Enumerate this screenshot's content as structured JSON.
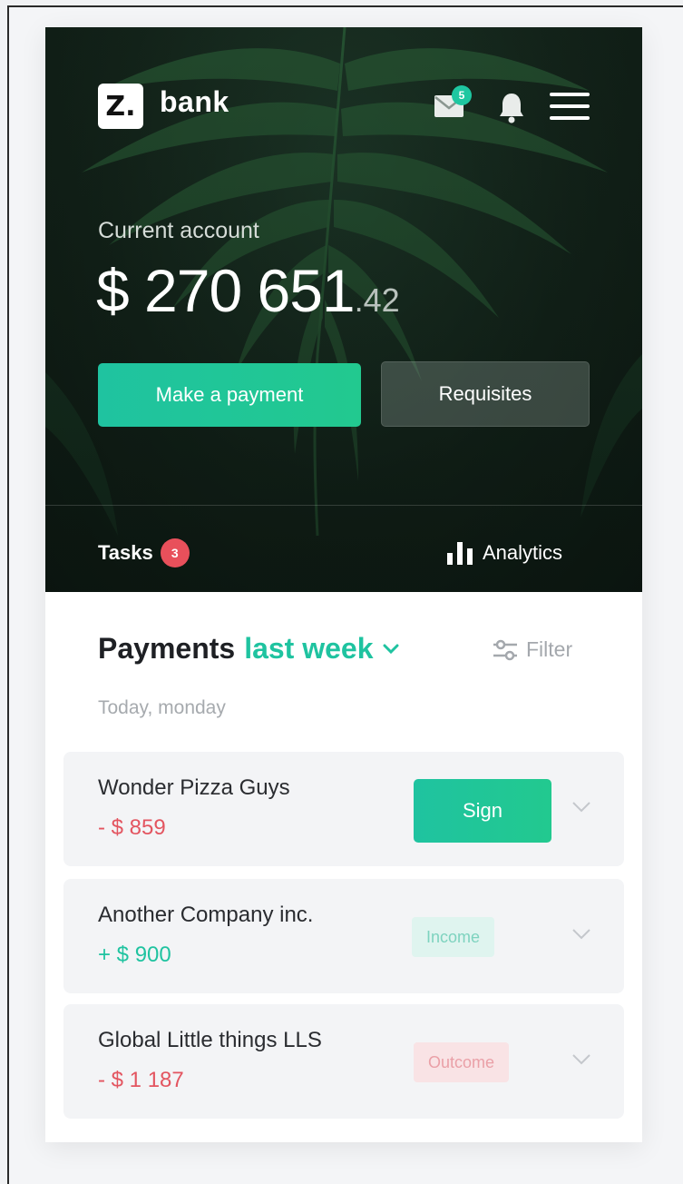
{
  "brand": {
    "logo_glyph": "Z.",
    "name": "bank"
  },
  "header": {
    "mail_icon": "mail-icon",
    "mail_badge": "5",
    "bell_icon": "bell-icon",
    "menu_icon": "menu-icon"
  },
  "account": {
    "label": "Current account",
    "balance_main": "$ 270 651",
    "balance_cents": ".42"
  },
  "actions": {
    "pay_label": "Make a payment",
    "requisites_label": "Requisites"
  },
  "tabs": {
    "tasks_label": "Tasks",
    "tasks_count": "3",
    "analytics_label": "Analytics",
    "analytics_icon": "bar-chart-icon"
  },
  "payments": {
    "title": "Payments",
    "period": "last week",
    "filter_label": "Filter",
    "filter_icon": "sliders-icon",
    "day_label": "Today, monday",
    "items": [
      {
        "name": "Wonder Pizza Guys",
        "amount": "- $ 859",
        "action_label": "Sign"
      },
      {
        "name": "Another Company inc.",
        "amount": "+ $ 900",
        "tag": "Income"
      },
      {
        "name": "Global Little things LLS",
        "amount": "- $ 1 187",
        "tag": "Outcome"
      }
    ]
  },
  "colors": {
    "accent": "#1fc3a0",
    "negative": "#e35560",
    "badge_red": "#e8505b",
    "hero_dark": "#14251b"
  }
}
